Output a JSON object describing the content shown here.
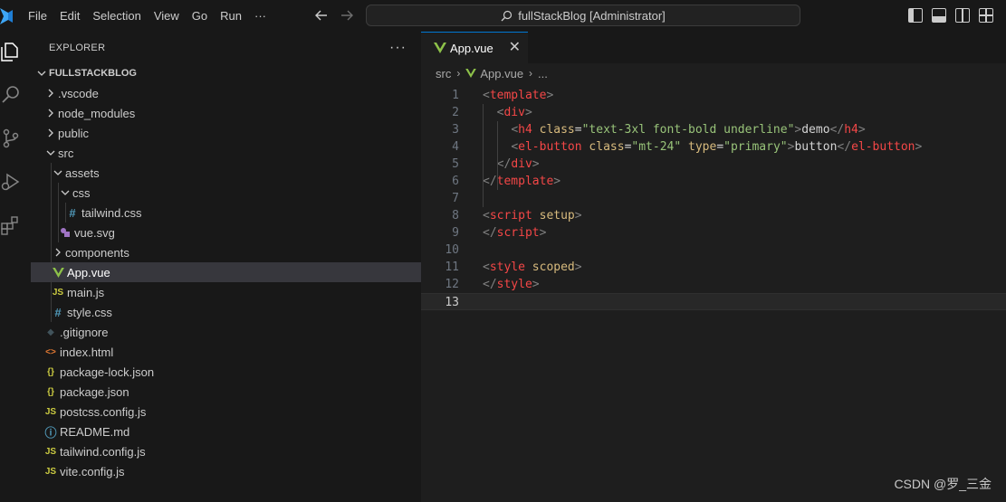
{
  "menu": [
    "File",
    "Edit",
    "Selection",
    "View",
    "Go",
    "Run",
    "···"
  ],
  "command_center": "fullStackBlog [Administrator]",
  "sidebar": {
    "title": "EXPLORER",
    "more": "···",
    "section": "FULLSTACKBLOG",
    "tree": [
      {
        "label": ".vscode",
        "kind": "folder",
        "open": false
      },
      {
        "label": "node_modules",
        "kind": "folder",
        "open": false
      },
      {
        "label": "public",
        "kind": "folder",
        "open": false
      },
      {
        "label": "src",
        "kind": "folder",
        "open": true
      },
      {
        "label": "assets",
        "kind": "folder",
        "open": true
      },
      {
        "label": "css",
        "kind": "folder",
        "open": true
      },
      {
        "label": "tailwind.css",
        "kind": "file",
        "icon": "#",
        "icon_color": "#519aba"
      },
      {
        "label": "vue.svg",
        "kind": "file",
        "icon": "svg",
        "icon_color": "#a074c4"
      },
      {
        "label": "components",
        "kind": "folder",
        "open": false
      },
      {
        "label": "App.vue",
        "kind": "file",
        "icon": "vue",
        "icon_color": "#8dc149",
        "selected": true
      },
      {
        "label": "main.js",
        "kind": "file",
        "icon": "JS",
        "icon_color": "#cbcb41"
      },
      {
        "label": "style.css",
        "kind": "file",
        "icon": "#",
        "icon_color": "#519aba"
      },
      {
        "label": ".gitignore",
        "kind": "file",
        "icon": "◆",
        "icon_color": "#41535b"
      },
      {
        "label": "index.html",
        "kind": "file",
        "icon": "<>",
        "icon_color": "#e37933"
      },
      {
        "label": "package-lock.json",
        "kind": "file",
        "icon": "{}",
        "icon_color": "#cbcb41"
      },
      {
        "label": "package.json",
        "kind": "file",
        "icon": "{}",
        "icon_color": "#cbcb41"
      },
      {
        "label": "postcss.config.js",
        "kind": "file",
        "icon": "JS",
        "icon_color": "#cbcb41"
      },
      {
        "label": "README.md",
        "kind": "file",
        "icon": "ⓘ",
        "icon_color": "#519aba"
      },
      {
        "label": "tailwind.config.js",
        "kind": "file",
        "icon": "JS",
        "icon_color": "#cbcb41"
      },
      {
        "label": "vite.config.js",
        "kind": "file",
        "icon": "JS",
        "icon_color": "#cbcb41"
      }
    ]
  },
  "editor": {
    "tab": {
      "label": "App.vue",
      "close": "✕"
    },
    "breadcrumb": [
      "src",
      "App.vue",
      "..."
    ],
    "active_line": 13,
    "lines": [
      [
        [
          "b",
          "<"
        ],
        [
          "tag",
          "template"
        ],
        [
          "b",
          ">"
        ]
      ],
      [
        [
          "txt",
          "  "
        ],
        [
          "b",
          "<"
        ],
        [
          "tag",
          "div"
        ],
        [
          "b",
          ">"
        ]
      ],
      [
        [
          "txt",
          "    "
        ],
        [
          "b",
          "<"
        ],
        [
          "tag",
          "h4"
        ],
        [
          "txt",
          " "
        ],
        [
          "attr",
          "class"
        ],
        [
          "eq",
          "="
        ],
        [
          "str",
          "\"text-3xl font-bold underline\""
        ],
        [
          "b",
          ">"
        ],
        [
          "txt",
          "demo"
        ],
        [
          "b",
          "</"
        ],
        [
          "tag",
          "h4"
        ],
        [
          "b",
          ">"
        ]
      ],
      [
        [
          "txt",
          "    "
        ],
        [
          "b",
          "<"
        ],
        [
          "tag",
          "el-button"
        ],
        [
          "txt",
          " "
        ],
        [
          "attr",
          "class"
        ],
        [
          "eq",
          "="
        ],
        [
          "str",
          "\"mt-24\""
        ],
        [
          "txt",
          " "
        ],
        [
          "attr",
          "type"
        ],
        [
          "eq",
          "="
        ],
        [
          "str",
          "\"primary\""
        ],
        [
          "b",
          ">"
        ],
        [
          "txt",
          "button"
        ],
        [
          "b",
          "</"
        ],
        [
          "tag",
          "el-button"
        ],
        [
          "b",
          ">"
        ]
      ],
      [
        [
          "txt",
          "  "
        ],
        [
          "b",
          "</"
        ],
        [
          "tag",
          "div"
        ],
        [
          "b",
          ">"
        ]
      ],
      [
        [
          "b",
          "</"
        ],
        [
          "tag",
          "template"
        ],
        [
          "b",
          ">"
        ]
      ],
      [],
      [
        [
          "b",
          "<"
        ],
        [
          "tag",
          "script"
        ],
        [
          "txt",
          " "
        ],
        [
          "attr",
          "setup"
        ],
        [
          "b",
          ">"
        ]
      ],
      [
        [
          "b",
          "</"
        ],
        [
          "tag",
          "script"
        ],
        [
          "b",
          ">"
        ]
      ],
      [],
      [
        [
          "b",
          "<"
        ],
        [
          "tag",
          "style"
        ],
        [
          "txt",
          " "
        ],
        [
          "attr",
          "scoped"
        ],
        [
          "b",
          ">"
        ]
      ],
      [
        [
          "b",
          "</"
        ],
        [
          "tag",
          "style"
        ],
        [
          "b",
          ">"
        ]
      ],
      []
    ]
  },
  "watermark": "CSDN @罗_三金",
  "colors": {
    "accent": "#0078d4",
    "vue": "#8dc149",
    "tag": "#f44747",
    "string": "#98c379",
    "attr": "#d7ba7d"
  }
}
